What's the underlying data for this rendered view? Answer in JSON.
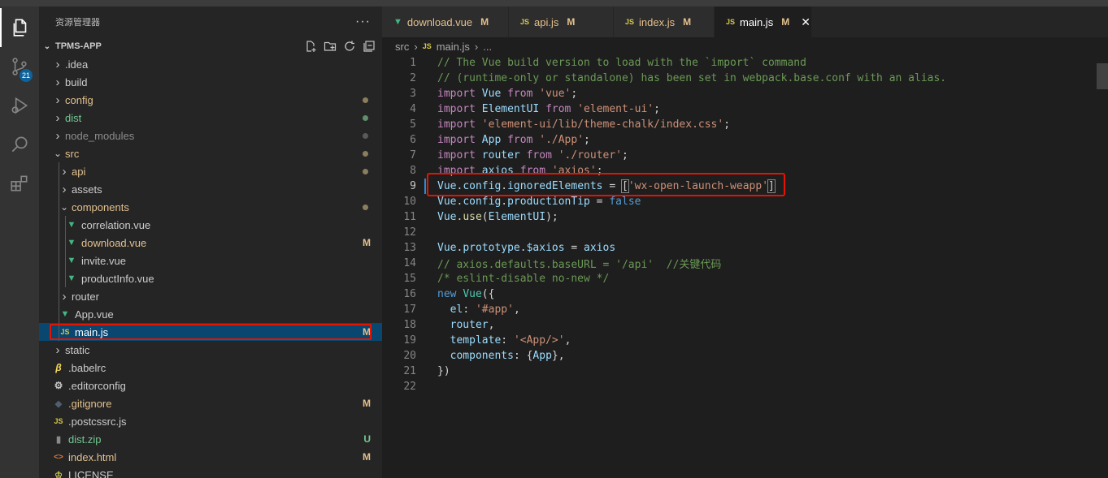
{
  "colors": {
    "modified": "#e2c08d",
    "untracked": "#73c991",
    "vue_icon": "#41b883",
    "js_icon": "#d6c84a",
    "highlight_box": "#e51400"
  },
  "activity_bar": {
    "items": [
      {
        "name": "explorer",
        "icon": "files-icon"
      },
      {
        "name": "source-control",
        "icon": "source-control-icon",
        "badge": "21"
      },
      {
        "name": "run-debug",
        "icon": "debug-icon"
      },
      {
        "name": "search",
        "icon": "search-icon"
      },
      {
        "name": "extensions",
        "icon": "extensions-icon"
      }
    ]
  },
  "sidebar": {
    "title": "资源管理器",
    "more": "···",
    "project": "TPMS-APP",
    "tree": [
      {
        "label": ".idea",
        "type": "folder",
        "collapsed": true,
        "depth": 0
      },
      {
        "label": "build",
        "type": "folder",
        "collapsed": true,
        "depth": 0
      },
      {
        "label": "config",
        "type": "folder",
        "collapsed": true,
        "depth": 0,
        "status": "dot-modified"
      },
      {
        "label": "dist",
        "type": "folder",
        "collapsed": true,
        "depth": 0,
        "status": "dot-untracked"
      },
      {
        "label": "node_modules",
        "type": "folder",
        "collapsed": true,
        "depth": 0,
        "status": "dot-ignored"
      },
      {
        "label": "src",
        "type": "folder",
        "collapsed": false,
        "depth": 0,
        "status": "dot-modified"
      },
      {
        "label": "api",
        "type": "folder",
        "collapsed": true,
        "depth": 1,
        "status": "dot-modified"
      },
      {
        "label": "assets",
        "type": "folder",
        "collapsed": true,
        "depth": 1
      },
      {
        "label": "components",
        "type": "folder",
        "collapsed": false,
        "depth": 1,
        "status": "dot-modified"
      },
      {
        "label": "correlation.vue",
        "type": "vue",
        "depth": 2
      },
      {
        "label": "download.vue",
        "type": "vue",
        "depth": 2,
        "status": "M"
      },
      {
        "label": "invite.vue",
        "type": "vue",
        "depth": 2
      },
      {
        "label": "productInfo.vue",
        "type": "vue",
        "depth": 2
      },
      {
        "label": "router",
        "type": "folder",
        "collapsed": true,
        "depth": 1
      },
      {
        "label": "App.vue",
        "type": "vue",
        "depth": 1
      },
      {
        "label": "main.js",
        "type": "js",
        "depth": 1,
        "status": "M",
        "selected": true
      },
      {
        "label": "static",
        "type": "folder",
        "collapsed": true,
        "depth": 0
      },
      {
        "label": ".babelrc",
        "type": "babel",
        "depth": 0
      },
      {
        "label": ".editorconfig",
        "type": "gear",
        "depth": 0
      },
      {
        "label": ".gitignore",
        "type": "git",
        "depth": 0,
        "status": "M"
      },
      {
        "label": ".postcssrc.js",
        "type": "js",
        "depth": 0
      },
      {
        "label": "dist.zip",
        "type": "zip",
        "depth": 0,
        "status": "U"
      },
      {
        "label": "index.html",
        "type": "html",
        "depth": 0,
        "status": "M"
      },
      {
        "label": "LICENSE",
        "type": "license",
        "depth": 0
      }
    ]
  },
  "tabs": [
    {
      "label": "download.vue",
      "type": "vue",
      "status": "M",
      "active": false
    },
    {
      "label": "api.js",
      "type": "js",
      "status": "M",
      "active": false
    },
    {
      "label": "index.js",
      "type": "js",
      "status": "M",
      "active": false
    },
    {
      "label": "main.js",
      "type": "js",
      "status": "M",
      "active": true,
      "close": "✕"
    }
  ],
  "breadcrumb": {
    "folder": "src",
    "file": "main.js",
    "ellipsis": "..."
  },
  "code": {
    "active_line": 9,
    "lines": [
      [
        [
          "c-com",
          "// The Vue build version to load with the `import` command"
        ]
      ],
      [
        [
          "c-com",
          "// (runtime-only or standalone) has been set in webpack.base.conf with an alias."
        ]
      ],
      [
        [
          "c-ctl",
          "import"
        ],
        [
          "c-pl",
          " "
        ],
        [
          "c-var",
          "Vue"
        ],
        [
          "c-pl",
          " "
        ],
        [
          "c-ctl",
          "from"
        ],
        [
          "c-pl",
          " "
        ],
        [
          "c-str",
          "'vue'"
        ],
        [
          "c-pl",
          ";"
        ]
      ],
      [
        [
          "c-ctl",
          "import"
        ],
        [
          "c-pl",
          " "
        ],
        [
          "c-var",
          "ElementUI"
        ],
        [
          "c-pl",
          " "
        ],
        [
          "c-ctl",
          "from"
        ],
        [
          "c-pl",
          " "
        ],
        [
          "c-str",
          "'element-ui'"
        ],
        [
          "c-pl",
          ";"
        ]
      ],
      [
        [
          "c-ctl",
          "import"
        ],
        [
          "c-pl",
          " "
        ],
        [
          "c-str",
          "'element-ui/lib/theme-chalk/index.css'"
        ],
        [
          "c-pl",
          ";"
        ]
      ],
      [
        [
          "c-ctl",
          "import"
        ],
        [
          "c-pl",
          " "
        ],
        [
          "c-var",
          "App"
        ],
        [
          "c-pl",
          " "
        ],
        [
          "c-ctl",
          "from"
        ],
        [
          "c-pl",
          " "
        ],
        [
          "c-str",
          "'./App'"
        ],
        [
          "c-pl",
          ";"
        ]
      ],
      [
        [
          "c-ctl",
          "import"
        ],
        [
          "c-pl",
          " "
        ],
        [
          "c-var",
          "router"
        ],
        [
          "c-pl",
          " "
        ],
        [
          "c-ctl",
          "from"
        ],
        [
          "c-pl",
          " "
        ],
        [
          "c-str",
          "'./router'"
        ],
        [
          "c-pl",
          ";"
        ]
      ],
      [
        [
          "c-ctl",
          "import"
        ],
        [
          "c-pl",
          " "
        ],
        [
          "c-var",
          "axios"
        ],
        [
          "c-pl",
          " "
        ],
        [
          "c-ctl",
          "from"
        ],
        [
          "c-pl",
          " "
        ],
        [
          "c-str",
          "'axios'"
        ],
        [
          "c-pl",
          ";"
        ]
      ],
      [
        [
          "c-var",
          "Vue"
        ],
        [
          "c-pl",
          "."
        ],
        [
          "c-var",
          "config"
        ],
        [
          "c-pl",
          "."
        ],
        [
          "c-var",
          "ignoredElements"
        ],
        [
          "c-pl",
          " = "
        ],
        [
          "c-pl br-box",
          "["
        ],
        [
          "c-str",
          "'wx-open-launch-weapp'"
        ],
        [
          "c-pl br-box",
          "]"
        ]
      ],
      [
        [
          "c-var",
          "Vue"
        ],
        [
          "c-pl",
          "."
        ],
        [
          "c-var",
          "config"
        ],
        [
          "c-pl",
          "."
        ],
        [
          "c-var",
          "productionTip"
        ],
        [
          "c-pl",
          " = "
        ],
        [
          "c-kw",
          "false"
        ]
      ],
      [
        [
          "c-var",
          "Vue"
        ],
        [
          "c-pl",
          "."
        ],
        [
          "c-fn",
          "use"
        ],
        [
          "c-pl",
          "("
        ],
        [
          "c-var",
          "ElementUI"
        ],
        [
          "c-pl",
          ");"
        ]
      ],
      [],
      [
        [
          "c-var",
          "Vue"
        ],
        [
          "c-pl",
          "."
        ],
        [
          "c-var",
          "prototype"
        ],
        [
          "c-pl",
          "."
        ],
        [
          "c-var",
          "$axios"
        ],
        [
          "c-pl",
          " = "
        ],
        [
          "c-var",
          "axios"
        ]
      ],
      [
        [
          "c-com",
          "// axios.defaults.baseURL = '/api'  //关键代码"
        ]
      ],
      [
        [
          "c-com",
          "/* eslint-disable no-new */"
        ]
      ],
      [
        [
          "c-kw",
          "new"
        ],
        [
          "c-pl",
          " "
        ],
        [
          "c-cls",
          "Vue"
        ],
        [
          "c-pl",
          "({"
        ]
      ],
      [
        [
          "c-pl",
          "  "
        ],
        [
          "c-var",
          "el"
        ],
        [
          "c-pl",
          ": "
        ],
        [
          "c-str",
          "'#app'"
        ],
        [
          "c-pl",
          ","
        ]
      ],
      [
        [
          "c-pl",
          "  "
        ],
        [
          "c-var",
          "router"
        ],
        [
          "c-pl",
          ","
        ]
      ],
      [
        [
          "c-pl",
          "  "
        ],
        [
          "c-var",
          "template"
        ],
        [
          "c-pl",
          ": "
        ],
        [
          "c-str",
          "'<App/>'"
        ],
        [
          "c-pl",
          ","
        ]
      ],
      [
        [
          "c-pl",
          "  "
        ],
        [
          "c-var",
          "components"
        ],
        [
          "c-pl",
          ": {"
        ],
        [
          "c-var",
          "App"
        ],
        [
          "c-pl",
          "},"
        ]
      ],
      [
        [
          "c-pl",
          "})"
        ]
      ],
      []
    ]
  }
}
